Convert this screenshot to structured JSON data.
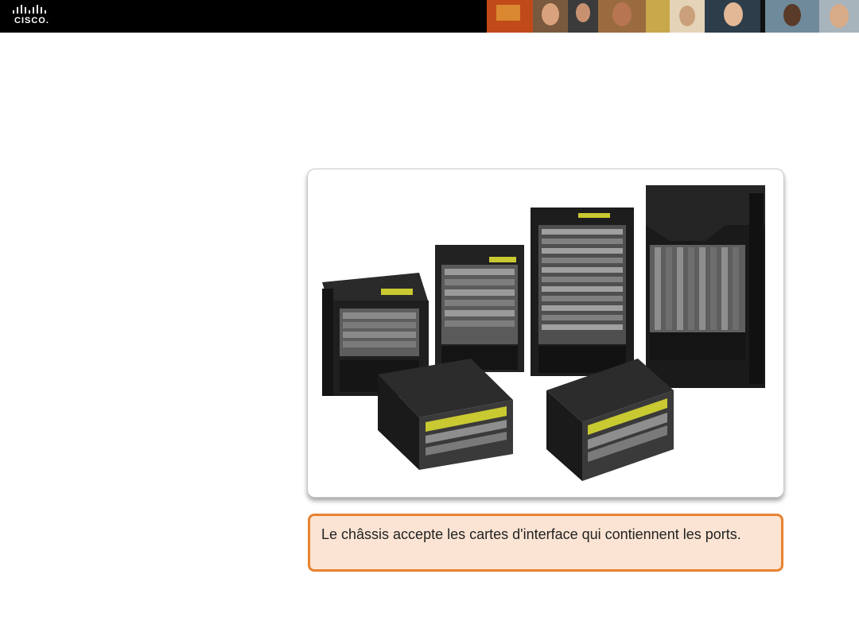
{
  "header": {
    "logo_text": "CISCO."
  },
  "figure": {
    "caption": "Le châssis accepte les cartes d'interface qui contiennent les ports."
  },
  "colors": {
    "header_bg": "#000000",
    "caption_border": "#e9822e",
    "caption_bg": "#fbe4d3"
  }
}
